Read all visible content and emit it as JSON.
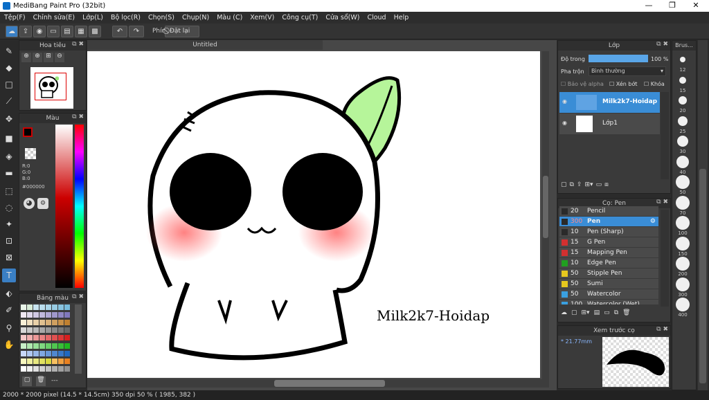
{
  "window": {
    "title": "MediBang Paint Pro (32bit)"
  },
  "menu": [
    "Tệp(F)",
    "Chỉnh sửa(E)",
    "Lớp(L)",
    "Bộ lọc(R)",
    "Chọn(S)",
    "Chụp(N)",
    "Màu (C)",
    "Xem(V)",
    "Công cụ(T)",
    "Cửa sổ(W)",
    "Cloud",
    "Help"
  ],
  "toolbar": {
    "key_label": "Phím",
    "reset_label": "Đặt lại"
  },
  "navigator": {
    "title": "Hoa tiêu"
  },
  "color_panel": {
    "title": "Màu",
    "r": "R:0",
    "g": "G:0",
    "b": "B:0",
    "hex": "#000000"
  },
  "palette_panel": {
    "title": "Bảng màu",
    "more": "---"
  },
  "document": {
    "tab": "Untitled",
    "watermark": "Milk2k7-Hoidap"
  },
  "layer_panel": {
    "title": "Lớp",
    "opacity_label": "Độ trong",
    "opacity_value": "100 %",
    "opacity_fraction": 1.0,
    "blend_label": "Pha trộn",
    "blend_value": "Bình thường",
    "protect_alpha": "Bảo vệ alpha",
    "clip": "Xén bớt",
    "lock": "Khóa",
    "layers": [
      {
        "name": "Milk2k7-Hoidap",
        "selected": true
      },
      {
        "name": "Lớp1",
        "selected": false
      }
    ]
  },
  "brush_panel": {
    "title": "Cọ: Pen",
    "brushes": [
      {
        "size": "20",
        "name": "Pencil",
        "color": "#2a2a2a",
        "selected": false
      },
      {
        "size": "300",
        "name": "Pen",
        "color": "#2a2a2a",
        "selected": true
      },
      {
        "size": "10",
        "name": "Pen (Sharp)",
        "color": "#2a2a2a",
        "selected": false
      },
      {
        "size": "15",
        "name": "G Pen",
        "color": "#d23030",
        "selected": false
      },
      {
        "size": "15",
        "name": "Mapping Pen",
        "color": "#d23030",
        "selected": false
      },
      {
        "size": "10",
        "name": "Edge Pen",
        "color": "#20a020",
        "selected": false
      },
      {
        "size": "50",
        "name": "Stipple Pen",
        "color": "#e6c81e",
        "selected": false
      },
      {
        "size": "50",
        "name": "Sumi",
        "color": "#e6c81e",
        "selected": false
      },
      {
        "size": "50",
        "name": "Watercolor",
        "color": "#3aa0e0",
        "selected": false
      },
      {
        "size": "100",
        "name": "Watercolor (Wet)",
        "color": "#3aa0e0",
        "selected": false
      }
    ]
  },
  "brush_preview": {
    "title": "Xem trước cọ",
    "size": "* 21.77mm"
  },
  "brush_size_panel": {
    "title": "Brus...",
    "sizes": [
      "12",
      "15",
      "20",
      "25",
      "30",
      "40",
      "50",
      "70",
      "100",
      "150",
      "200",
      "300",
      "400"
    ]
  },
  "status": {
    "size": "2000 * 2000 pixel",
    "cm": "(14.5 * 14.5cm)",
    "dpi": "350 dpi",
    "zoom": "50 %",
    "coords": "( 1985, 382 )"
  }
}
